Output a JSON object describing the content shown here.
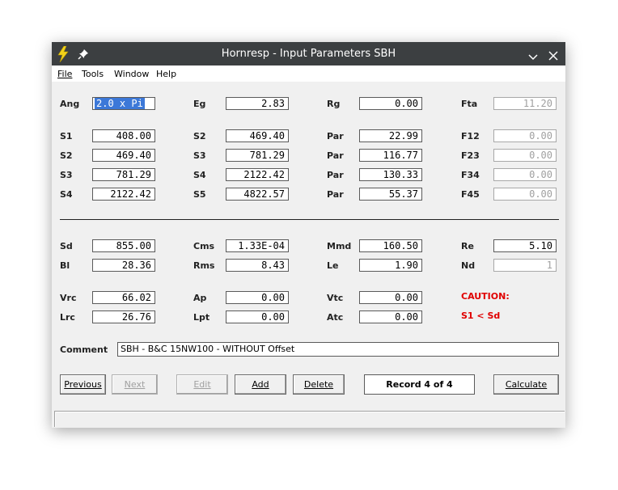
{
  "window": {
    "title": "Hornresp - Input Parameters SBH"
  },
  "menu": [
    "File",
    "Tools",
    "Window",
    "Help"
  ],
  "rows": [
    [
      {
        "label": "Ang",
        "value": "2.0 x Pi",
        "selected": true
      },
      {
        "label": "Eg",
        "value": "2.83"
      },
      {
        "label": "Rg",
        "value": "0.00"
      },
      {
        "label": "Fta",
        "value": "11.20",
        "disabled": true
      }
    ],
    [
      {
        "label": "S1",
        "value": "408.00"
      },
      {
        "label": "S2",
        "value": "469.40"
      },
      {
        "label": "Par",
        "value": "22.99"
      },
      {
        "label": "F12",
        "value": "0.00",
        "disabled": true
      }
    ],
    [
      {
        "label": "S2",
        "value": "469.40"
      },
      {
        "label": "S3",
        "value": "781.29"
      },
      {
        "label": "Par",
        "value": "116.77"
      },
      {
        "label": "F23",
        "value": "0.00",
        "disabled": true
      }
    ],
    [
      {
        "label": "S3",
        "value": "781.29"
      },
      {
        "label": "S4",
        "value": "2122.42"
      },
      {
        "label": "Par",
        "value": "130.33"
      },
      {
        "label": "F34",
        "value": "0.00",
        "disabled": true
      }
    ],
    [
      {
        "label": "S4",
        "value": "2122.42"
      },
      {
        "label": "S5",
        "value": "4822.57"
      },
      {
        "label": "Par",
        "value": "55.37"
      },
      {
        "label": "F45",
        "value": "0.00",
        "disabled": true
      }
    ],
    [
      {
        "label": "Sd",
        "value": "855.00"
      },
      {
        "label": "Cms",
        "value": "1.33E-04"
      },
      {
        "label": "Mmd",
        "value": "160.50"
      },
      {
        "label": "Re",
        "value": "5.10"
      }
    ],
    [
      {
        "label": "Bl",
        "value": "28.36"
      },
      {
        "label": "Rms",
        "value": "8.43"
      },
      {
        "label": "Le",
        "value": "1.90"
      },
      {
        "label": "Nd",
        "value": "1",
        "disabled": true
      }
    ],
    [
      {
        "label": "Vrc",
        "value": "66.02"
      },
      {
        "label": "Ap",
        "value": "0.00"
      },
      {
        "label": "Vtc",
        "value": "0.00"
      }
    ],
    [
      {
        "label": "Lrc",
        "value": "26.76"
      },
      {
        "label": "Lpt",
        "value": "0.00"
      },
      {
        "label": "Atc",
        "value": "0.00"
      }
    ]
  ],
  "caution": {
    "title": "CAUTION:",
    "message": "S1 < Sd"
  },
  "comment": {
    "label": "Comment",
    "value": "SBH - B&C 15NW100 - WITHOUT Offset"
  },
  "buttons": {
    "previous": "Previous",
    "next": "Next",
    "edit": "Edit",
    "add": "Add",
    "delete": "Delete",
    "calculate": "Calculate"
  },
  "record": "Record 4 of 4",
  "colors": {
    "titlebar": "#3c3f41",
    "caution": "#e00000",
    "selection": "#3c78d8"
  }
}
